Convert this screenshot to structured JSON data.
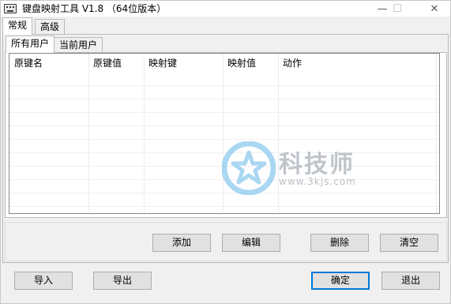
{
  "window": {
    "title": "键盘映射工具 V1.8 （64位版本）",
    "controls": {
      "minimize": "—",
      "maximize": "☐",
      "close": "✕"
    }
  },
  "outer_tabs": [
    {
      "label": "常规",
      "active": true
    },
    {
      "label": "高级",
      "active": false
    }
  ],
  "inner_tabs": [
    {
      "label": "所有用户",
      "active": true
    },
    {
      "label": "当前用户",
      "active": false
    }
  ],
  "list": {
    "columns": [
      "原键名",
      "原键值",
      "映射键",
      "映射值",
      "动作"
    ],
    "rows": []
  },
  "actions": {
    "add": "添加",
    "edit": "编辑",
    "delete": "删除",
    "clear": "清空"
  },
  "footer": {
    "import": "导入",
    "export": "导出",
    "ok": "确定",
    "exit": "退出"
  },
  "watermark": {
    "text": "科技师",
    "url": "www.3kjs.com"
  },
  "colors": {
    "accent": "#0078d7",
    "watermark": "#8ec9ee"
  }
}
